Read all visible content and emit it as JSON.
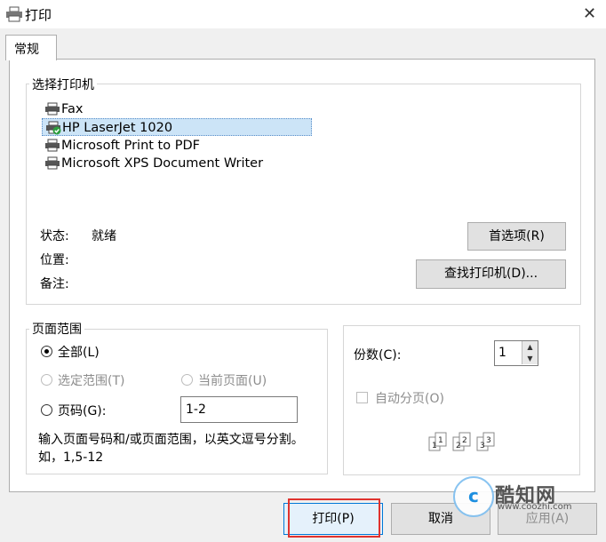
{
  "window": {
    "title": "打印"
  },
  "tabs": [
    {
      "label": "常规",
      "active": true
    }
  ],
  "printer_section": {
    "title": "选择打印机",
    "printers": [
      {
        "name": "Fax",
        "selected": false,
        "default": false
      },
      {
        "name": "HP LaserJet 1020",
        "selected": true,
        "default": true
      },
      {
        "name": "Microsoft Print to PDF",
        "selected": false,
        "default": false
      },
      {
        "name": "Microsoft XPS Document Writer",
        "selected": false,
        "default": false
      }
    ],
    "status_label": "状态:",
    "status_value": "就绪",
    "location_label": "位置:",
    "comment_label": "备注:",
    "preferences_button": "首选项(R)",
    "find_printer_button": "查找打印机(D)..."
  },
  "page_range": {
    "title": "页面范围",
    "all": "全部(L)",
    "selection": "选定范围(T)",
    "current_page": "当前页面(U)",
    "pages": "页码(G):",
    "pages_value": "1-2",
    "hint": "输入页面号码和/或页面范围，以英文逗号分割。如，1,5-12",
    "selected_option": "all"
  },
  "copies": {
    "label": "份数(C):",
    "value": "1",
    "collate_label": "自动分页(O)",
    "collate_checked": false,
    "collate_icon_labels": [
      "1",
      "1",
      "2",
      "2",
      "3",
      "3"
    ]
  },
  "buttons": {
    "print": "打印(P)",
    "cancel": "取消",
    "apply": "应用(A)"
  },
  "watermark": {
    "logo_letter": "c",
    "text": "酷知网",
    "url": "www.coozhi.com"
  },
  "colors": {
    "selection_bg": "#cce4f7",
    "highlight_border": "#e0332f",
    "focus_border": "#0078d7"
  }
}
